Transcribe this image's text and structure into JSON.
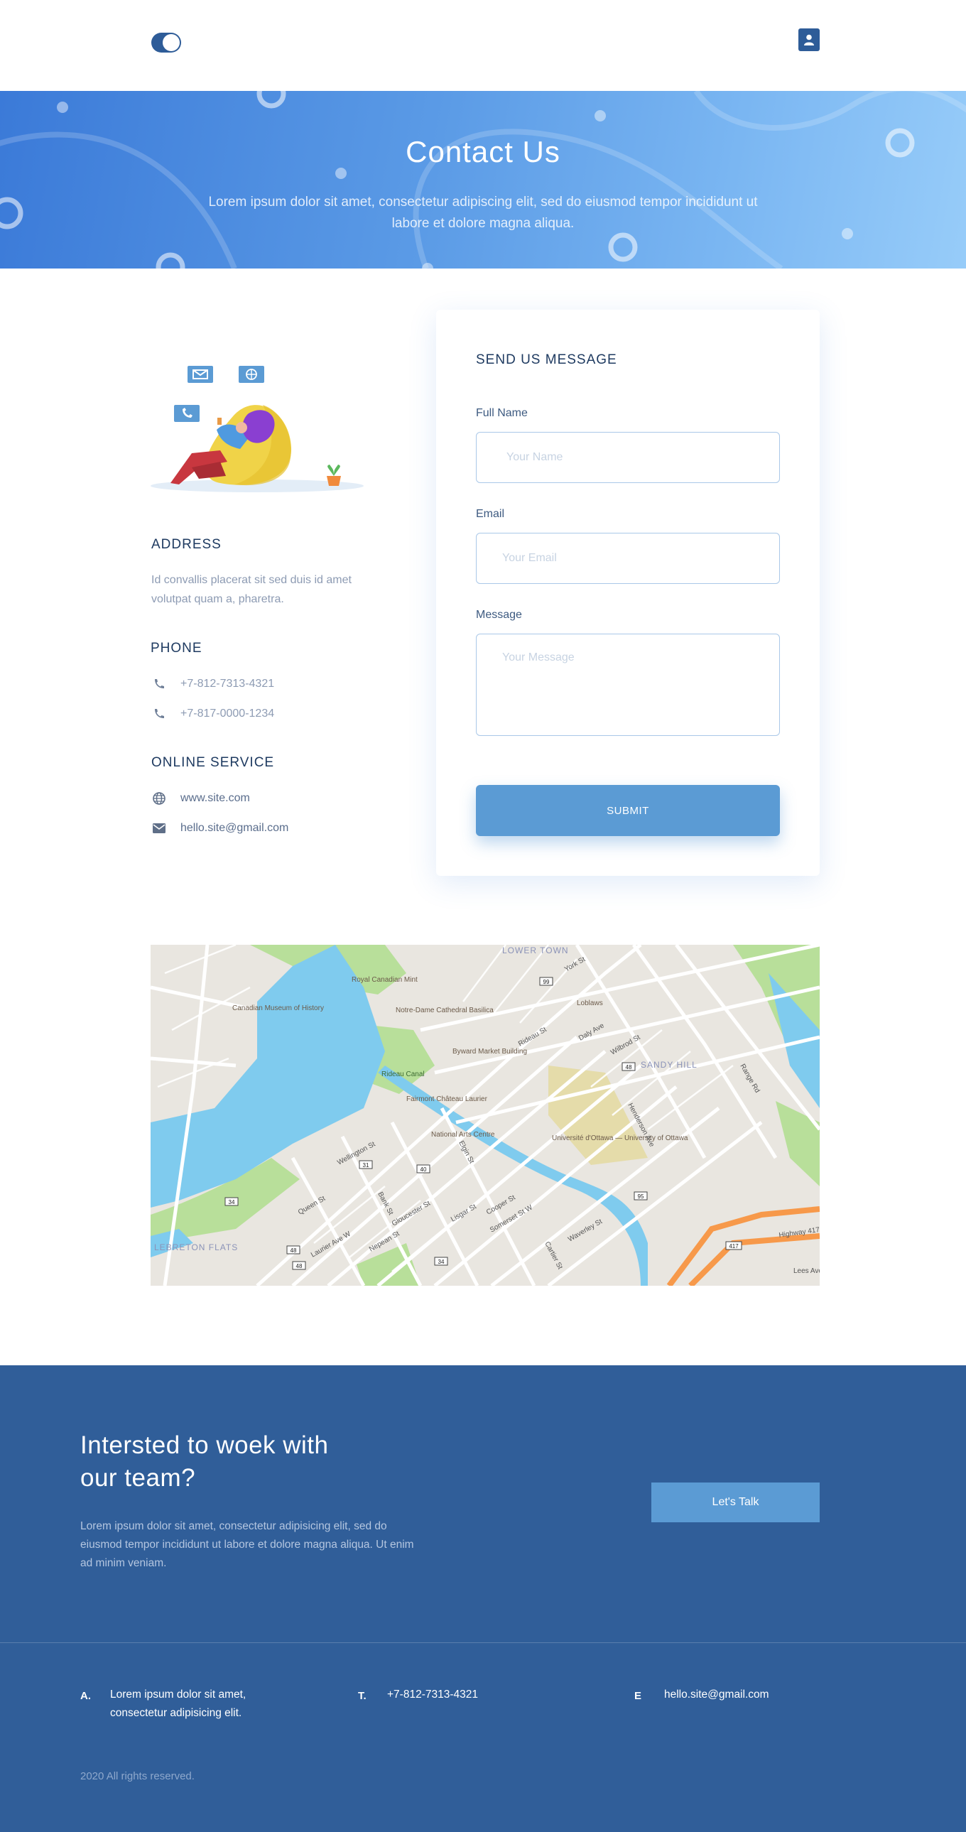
{
  "header": {
    "logo_icon": "toggle-logo",
    "user_icon": "user-icon"
  },
  "hero": {
    "title": "Contact Us",
    "subtitle": "Lorem ipsum dolor sit amet, consectetur adipiscing elit, sed do eiusmod tempor incididunt ut labore et dolore magna aliqua."
  },
  "contact": {
    "address_title": "ADDRESS",
    "address_text": "Id convallis placerat sit sed duis id amet volutpat quam a, pharetra.",
    "phone_title": "PHONE",
    "phones": [
      "+7-812-7313-4321",
      "+7-817-0000-1234"
    ],
    "online_title": "ONLINE SERVICE",
    "website": "www.site.com",
    "email": "hello.site@gmail.com"
  },
  "form": {
    "title": "SEND US MESSAGE",
    "name_label": "Full Name",
    "name_placeholder": "Your Name",
    "email_label": "Email",
    "email_placeholder": "Your Email",
    "message_label": "Message",
    "message_placeholder": "Your Message",
    "submit_label": "SUBMIT"
  },
  "map": {
    "labels": {
      "lower_town": "LOWER TOWN",
      "royal_mint": "Royal Canadian Mint",
      "museum": "Canadian Museum of History",
      "notre_dame": "Notre-Dame Cathedral Basilica",
      "byward": "Byward Market Building",
      "loblaws": "Loblaws",
      "sandy_hill": "SANDY HILL",
      "rideau_canal": "Rideau Canal",
      "fairmont": "Fairmont Château Laurier",
      "nac": "National Arts Centre",
      "uottawa": "Université d'Ottawa — University of Ottawa",
      "lebreton": "LEBRETON FLATS",
      "wellington": "Wellington St",
      "york": "York St",
      "rideau_st": "Rideau St",
      "daly": "Daly Ave",
      "wilbrod": "Wilbrod St",
      "range": "Range Rd",
      "henderson": "Henderson Ave",
      "elgin": "Elgin St",
      "queen": "Queen St",
      "bank": "Bank St",
      "lisgar": "Lisgar St",
      "laurier": "Laurier Ave W",
      "nepean": "Nepean St",
      "gloucester": "Gloucester St",
      "cooper": "Cooper St",
      "somerset": "Somerset St W",
      "waverley": "Waverley St",
      "cartier": "Cartier St",
      "highway": "Highway 417",
      "lees": "Lees Ave"
    },
    "shields": [
      "99",
      "48",
      "31",
      "40",
      "34",
      "48",
      "48",
      "34",
      "95",
      "417"
    ]
  },
  "footer": {
    "cta_title": "Intersted to woek with our team?",
    "cta_text": "Lorem ipsum dolor sit amet, consectetur adipisicing elit, sed do eiusmod tempor incididunt ut labore et dolore magna aliqua. Ut enim ad minim veniam.",
    "cta_button": "Let's Talk",
    "address_letter": "A.",
    "address": "Lorem ipsum dolor sit amet, consectetur adipisicing elit.",
    "phone_letter": "T.",
    "phone": "+7-812-7313-4321",
    "email_letter": "E",
    "email": "hello.site@gmail.com",
    "copyright": "2020 All rights reserved."
  },
  "colors": {
    "brand_dark": "#305e99",
    "accent": "#5b9bd4",
    "hero_start": "#3b7ad8",
    "hero_end": "#97ccf9"
  }
}
